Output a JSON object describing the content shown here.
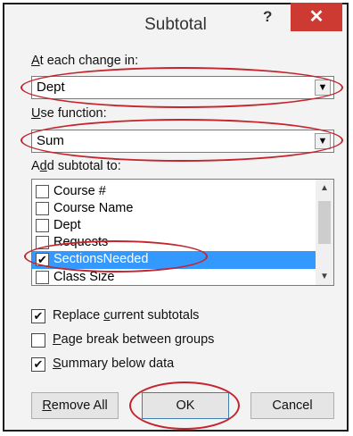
{
  "dialog": {
    "title": "Subtotal",
    "help": "?",
    "close": "✕"
  },
  "at_each_change": {
    "label_u": "A",
    "label_rest": "t each change in:",
    "value": "Dept"
  },
  "use_function": {
    "label_u": "U",
    "label_rest": "se function:",
    "value": "Sum"
  },
  "add_subtotal": {
    "label_pre": "A",
    "label_u": "d",
    "label_rest": "d subtotal to:",
    "items": [
      {
        "label": "Course #",
        "checked": false
      },
      {
        "label": "Course Name",
        "checked": false
      },
      {
        "label": "Dept",
        "checked": false
      },
      {
        "label": "Requests",
        "checked": false
      },
      {
        "label": "SectionsNeeded",
        "checked": true
      },
      {
        "label": "Class Size",
        "checked": false
      }
    ]
  },
  "options": {
    "replace": {
      "pre": "Replace ",
      "u": "c",
      "rest": "urrent subtotals",
      "checked": true
    },
    "page_break": {
      "pre": "",
      "u": "P",
      "rest": "age break between groups",
      "checked": false
    },
    "summary": {
      "pre": "",
      "u": "S",
      "rest": "ummary below data",
      "checked": true
    }
  },
  "buttons": {
    "remove_u": "R",
    "remove_rest": "emove All",
    "ok": "OK",
    "cancel": "Cancel"
  },
  "colors": {
    "annotation": "#c4252c",
    "selection": "#3399ff",
    "close": "#cd3a31"
  }
}
